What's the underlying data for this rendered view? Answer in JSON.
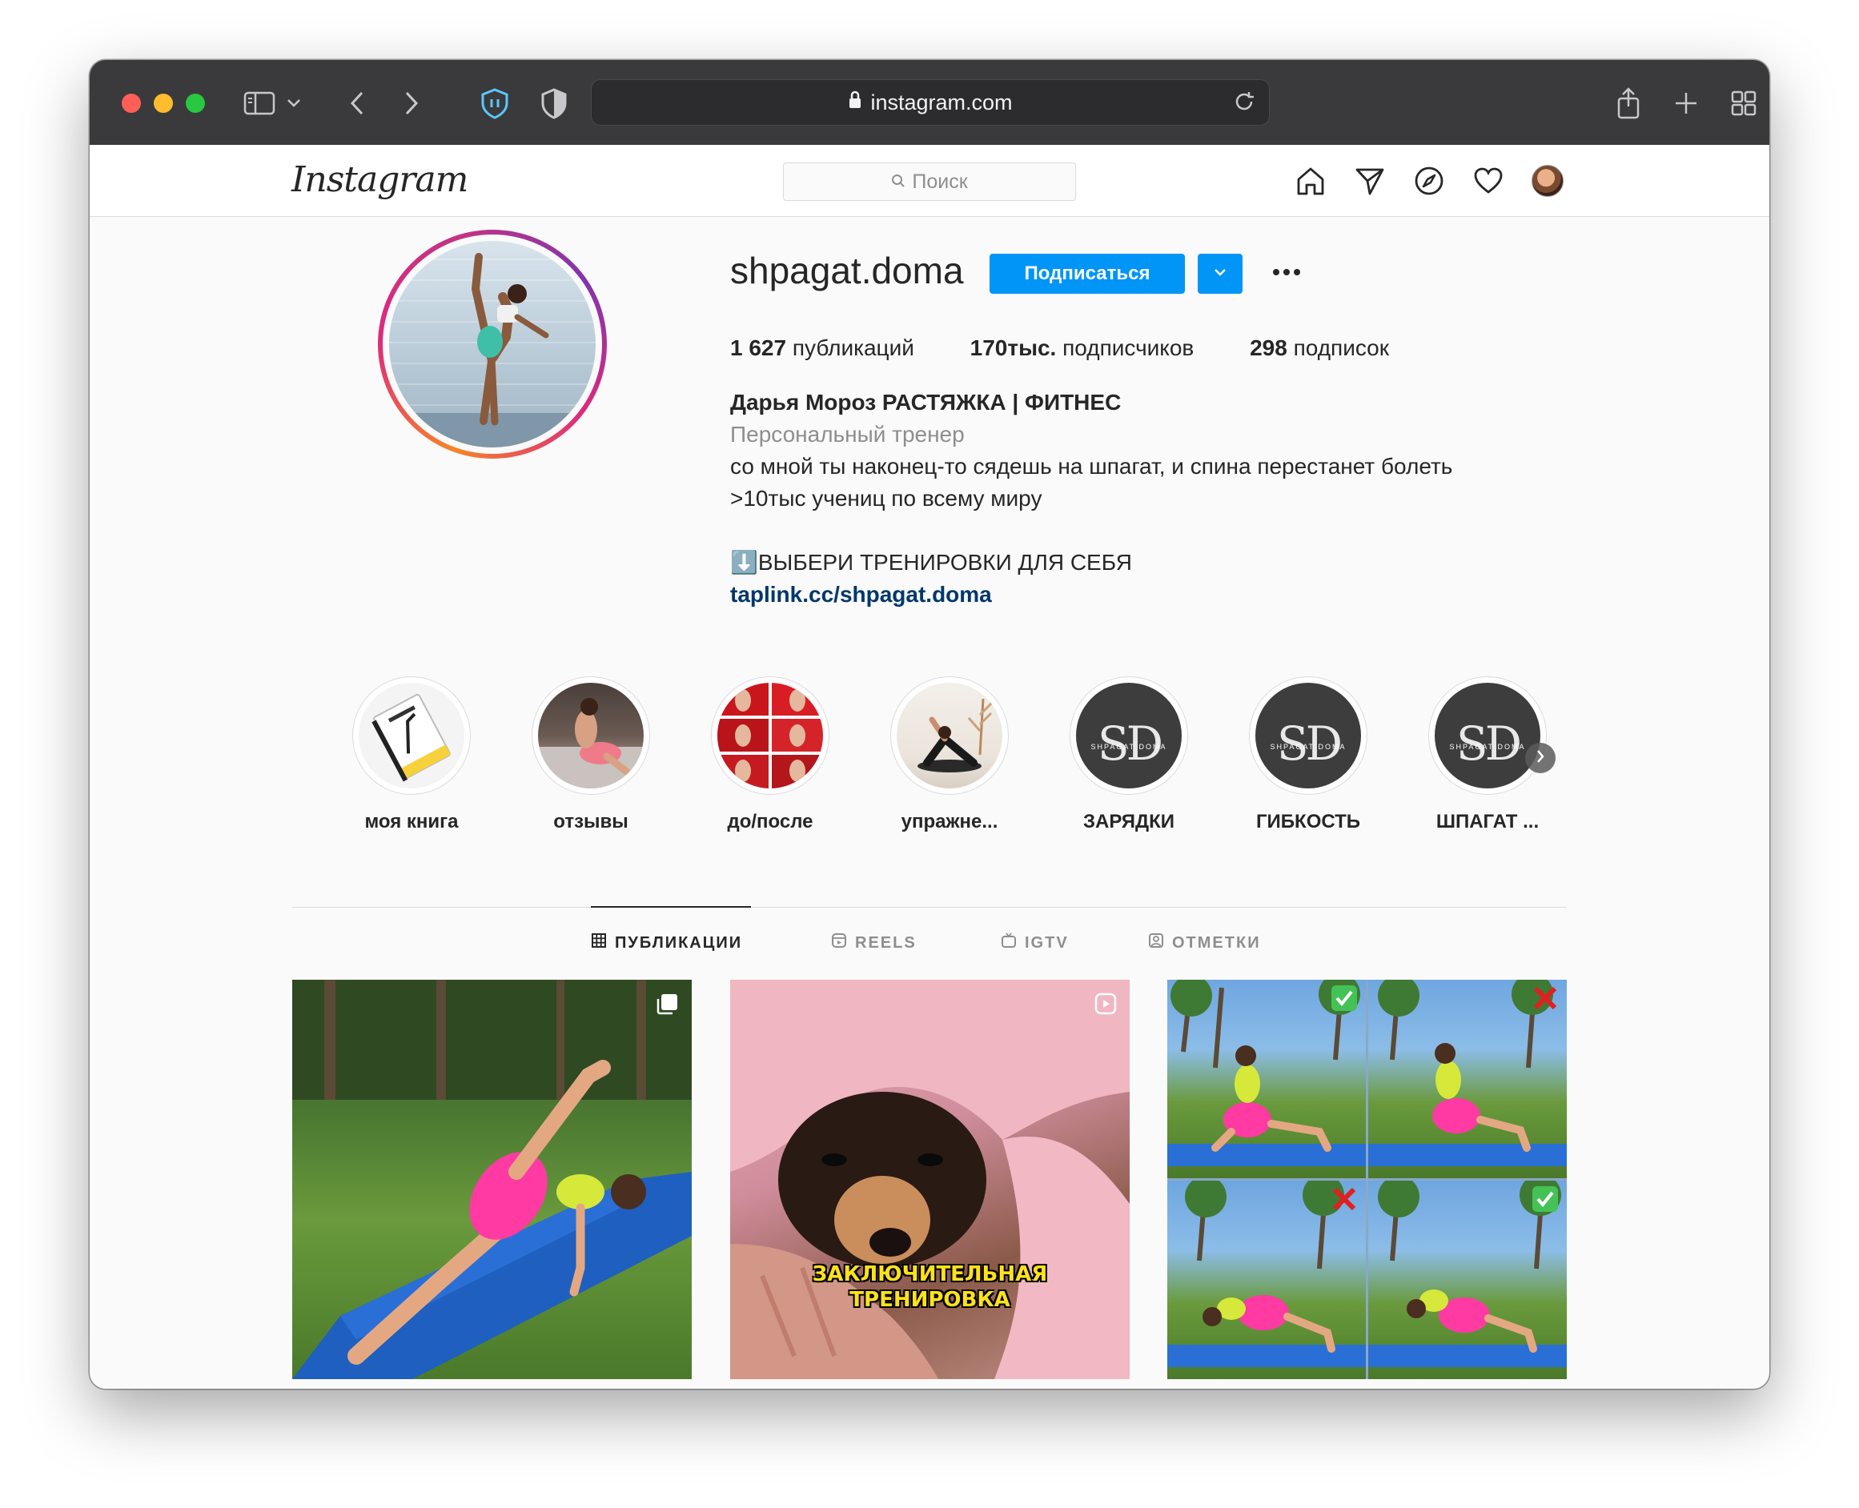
{
  "browser": {
    "url": "instagram.com"
  },
  "header": {
    "logo": "Instagram",
    "search_placeholder": "Поиск"
  },
  "profile": {
    "username": "shpagat.doma",
    "follow_label": "Подписаться",
    "stats": [
      {
        "value": "1 627",
        "label": "публикаций"
      },
      {
        "value": "170тыс.",
        "label": "подписчиков"
      },
      {
        "value": "298",
        "label": "подписок"
      }
    ],
    "full_name": "Дарья Мороз РАСТЯЖКА | ФИТНЕС",
    "category": "Персональный тренер",
    "bio_line1": "со мной ты наконец-то сядешь на шпагат, и спина перестанет болеть",
    "bio_line2": ">10тыс учениц по всему миру",
    "bio_line3": "⬇️ВЫБЕРИ ТРЕНИРОВКИ ДЛЯ СЕБЯ",
    "link": "taplink.cc/shpagat.doma"
  },
  "highlights": [
    {
      "label": "моя книга"
    },
    {
      "label": "отзывы"
    },
    {
      "label": "до/после"
    },
    {
      "label": "упражне..."
    },
    {
      "label": "ЗАРЯДКИ",
      "logo_text": "SD",
      "logo_sub": "SHPAGAT DOMA"
    },
    {
      "label": "ГИБКОСТЬ",
      "logo_text": "SD",
      "logo_sub": "SHPAGAT DOMA"
    },
    {
      "label": "ШПАГАТ ...",
      "logo_text": "SD",
      "logo_sub": "SHPAGAT DOMA"
    }
  ],
  "tabs": [
    {
      "label": "ПУБЛИКАЦИИ",
      "active": true
    },
    {
      "label": "REELS"
    },
    {
      "label": "IGTV"
    },
    {
      "label": "ОТМЕТКИ"
    }
  ],
  "posts": [
    {
      "type": "carousel"
    },
    {
      "type": "video",
      "caption_line1": "ЗАКЛЮЧИТЕЛЬНАЯ",
      "caption_line2": "ТРЕНИРОВКА"
    },
    {
      "type": "image"
    }
  ],
  "colors": {
    "accent": "#0095f6",
    "link": "#00376b",
    "text": "#262626",
    "muted": "#8e8e8e"
  }
}
